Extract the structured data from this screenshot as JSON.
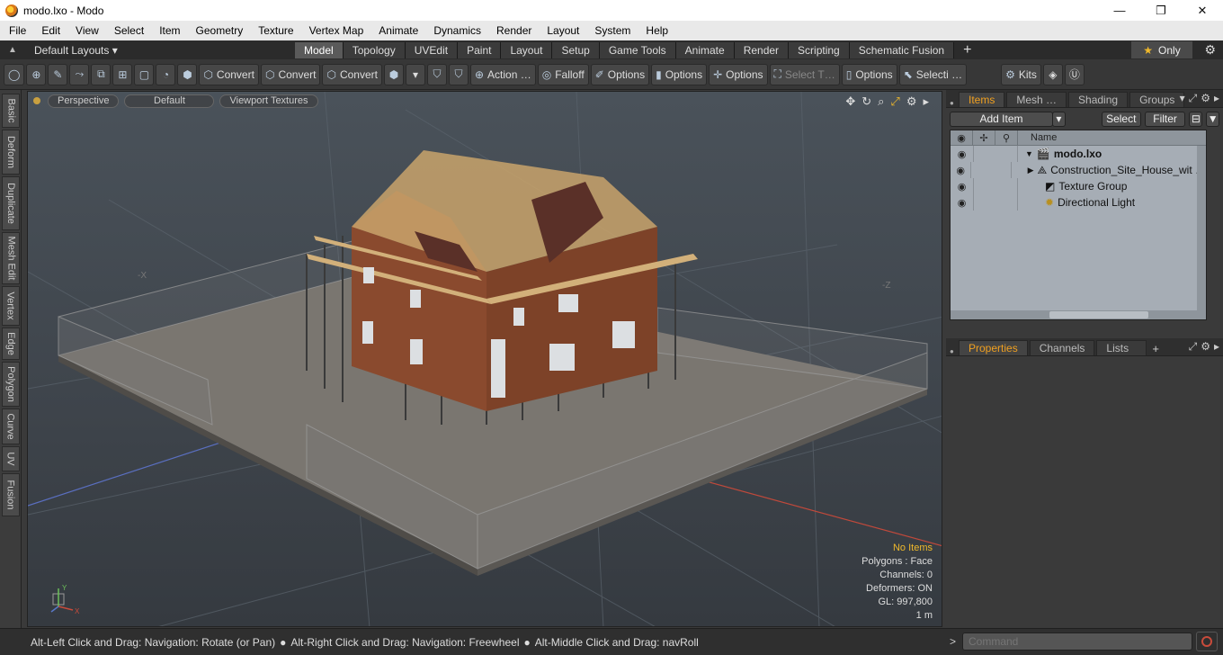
{
  "window": {
    "title": "modo.lxo - Modo",
    "minimize": "—",
    "maximize": "❐",
    "close": "✕"
  },
  "menu": [
    "File",
    "Edit",
    "View",
    "Select",
    "Item",
    "Geometry",
    "Texture",
    "Vertex Map",
    "Animate",
    "Dynamics",
    "Render",
    "Layout",
    "System",
    "Help"
  ],
  "layouts": {
    "dropdown": "Default Layouts ▾",
    "tabs": [
      "Model",
      "Topology",
      "UVEdit",
      "Paint",
      "Layout",
      "Setup",
      "Game Tools",
      "Animate",
      "Render",
      "Scripting",
      "Schematic Fusion"
    ],
    "active": "Model",
    "plus": "+",
    "only": "Only"
  },
  "toolbar": {
    "convert1": "Convert",
    "convert2": "Convert",
    "convert3": "Convert",
    "action": "Action …",
    "falloff": "Falloff",
    "options1": "Options",
    "options2": "Options",
    "options3": "Options",
    "select_t": "Select T…",
    "options4": "Options",
    "selecti": "Selecti …",
    "kits": "Kits"
  },
  "left_tabs": [
    "Basic",
    "Deform",
    "Duplicate",
    "Mesh Edit",
    "Vertex",
    "Edge",
    "Polygon",
    "Curve",
    "UV",
    "Fusion"
  ],
  "viewport": {
    "view": "Perspective",
    "shading": "Default",
    "textures": "Viewport Textures",
    "axis_labels": {
      "neg_x": "-X",
      "neg_z": "-Z"
    },
    "info": {
      "no_items": "No Items",
      "polygons": "Polygons : Face",
      "channels": "Channels: 0",
      "deformers": "Deformers: ON",
      "gl": "GL: 997,800",
      "scale": "1 m"
    },
    "gizmo": {
      "y": "Y",
      "x": "X"
    }
  },
  "items_panel": {
    "tabs": [
      "Items",
      "Mesh …",
      "Shading",
      "Groups"
    ],
    "active": "Items",
    "add_item": "Add Item",
    "select": "Select",
    "filter": "Filter",
    "column_name": "Name",
    "rows": [
      {
        "name": "modo.lxo",
        "bold": true
      },
      {
        "name": "Construction_Site_House_wit …",
        "bold": false
      },
      {
        "name": "Texture Group",
        "bold": false
      },
      {
        "name": "Directional Light",
        "bold": false
      }
    ]
  },
  "properties_panel": {
    "tabs": [
      "Properties",
      "Channels",
      "Lists"
    ],
    "active": "Properties",
    "plus": "+"
  },
  "status": {
    "hint1": "Alt-Left Click and Drag: Navigation: Rotate (or Pan)",
    "hint2": "Alt-Right Click and Drag: Navigation: Freewheel",
    "hint3": "Alt-Middle Click and Drag: navRoll",
    "command_placeholder": "Command"
  },
  "colors": {
    "accent": "#f0a020",
    "star": "#f0b92b",
    "record": "#c84b3b"
  }
}
